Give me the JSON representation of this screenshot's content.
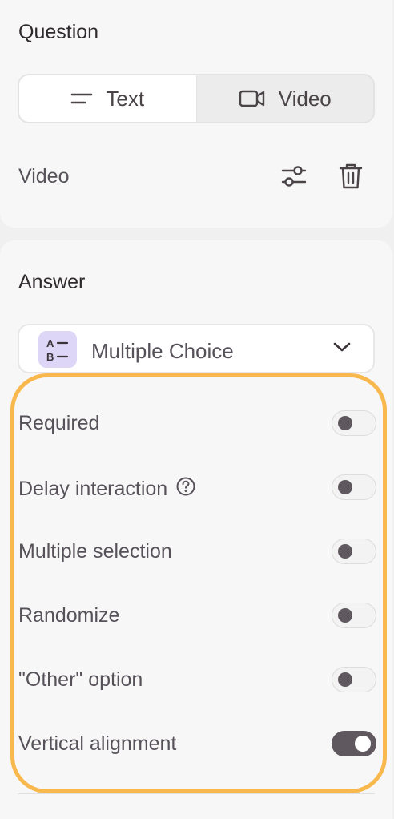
{
  "question": {
    "title": "Question",
    "tabs": [
      {
        "label": "Text",
        "icon": "text-lines-icon",
        "selected": true
      },
      {
        "label": "Video",
        "icon": "video-camera-icon",
        "selected": false
      }
    ],
    "media_label": "Video",
    "actions": {
      "settings_icon": "sliders-icon",
      "delete_icon": "trash-icon"
    }
  },
  "answer": {
    "title": "Answer",
    "type_select": {
      "value": "Multiple Choice",
      "icon": "multiple-choice-icon",
      "icon_text_a": "A",
      "icon_text_b": "B"
    },
    "options": [
      {
        "label": "Required",
        "on": false
      },
      {
        "label": "Delay interaction",
        "on": false,
        "help": true
      },
      {
        "label": "Multiple selection",
        "on": false
      },
      {
        "label": "Randomize",
        "on": false
      },
      {
        "label": "\"Other\" option",
        "on": false
      },
      {
        "label": "Vertical alignment",
        "on": true
      }
    ]
  },
  "colors": {
    "highlight": "#f8b84e",
    "toggle_on": "#5f585f",
    "type_icon_bg": "#ddd6f7"
  }
}
